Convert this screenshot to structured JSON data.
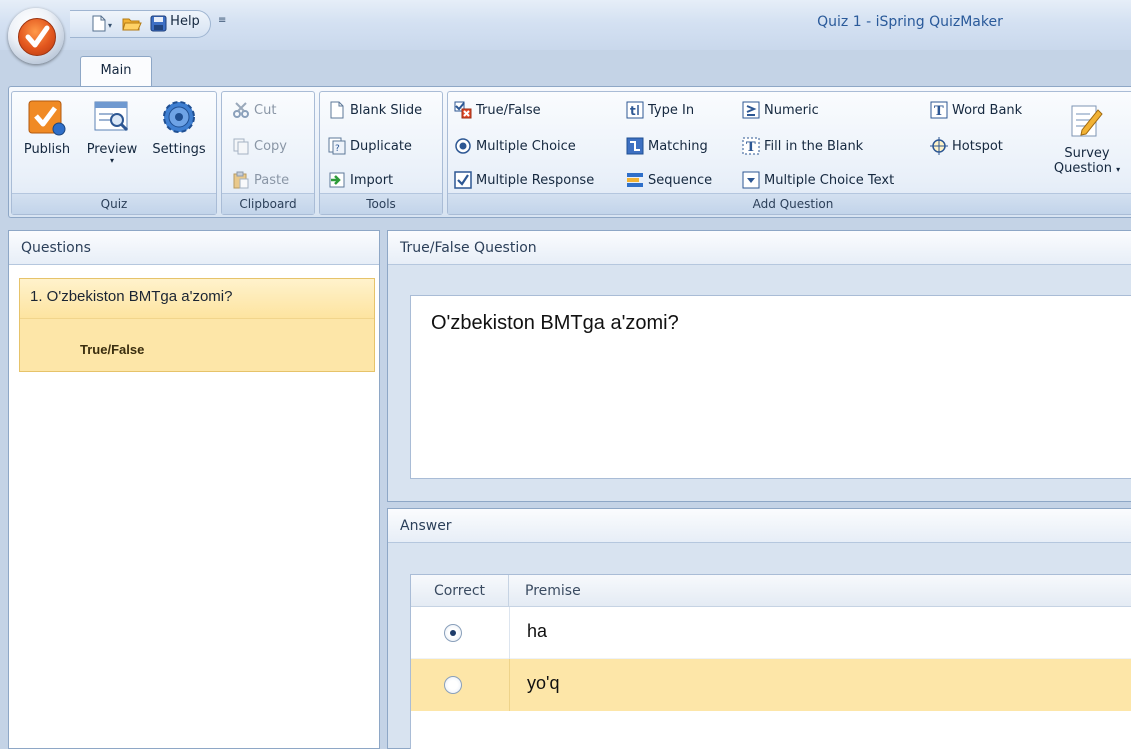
{
  "window": {
    "title": "Quiz 1 - iSpring QuizMaker"
  },
  "qat": {
    "icons": [
      "new-icon",
      "open-icon",
      "save-icon",
      "customize-icon"
    ]
  },
  "ribbon": {
    "tabs": [
      {
        "label": "Main",
        "active": true
      },
      {
        "label": "Help",
        "active": false
      }
    ],
    "groups": {
      "quiz": {
        "label": "Quiz",
        "publish": "Publish",
        "preview": "Preview",
        "settings": "Settings"
      },
      "clipboard": {
        "label": "Clipboard",
        "cut": "Cut",
        "copy": "Copy",
        "paste": "Paste"
      },
      "tools": {
        "label": "Tools",
        "blank_slide": "Blank Slide",
        "duplicate": "Duplicate",
        "import": "Import"
      },
      "add_question": {
        "label": "Add Question",
        "true_false": "True/False",
        "multiple_choice": "Multiple Choice",
        "multiple_response": "Multiple Response",
        "type_in": "Type In",
        "matching": "Matching",
        "sequence": "Sequence",
        "numeric": "Numeric",
        "fill_in_blank": "Fill in the Blank",
        "multiple_choice_text": "Multiple Choice Text",
        "word_bank": "Word Bank",
        "hotspot": "Hotspot",
        "survey_line1": "Survey",
        "survey_line2": "Question"
      }
    }
  },
  "questions_panel": {
    "header": "Questions",
    "items": [
      {
        "text": "1. O'zbekiston BMTga a'zomi?",
        "type": "True/False"
      }
    ]
  },
  "question_panel": {
    "header": "True/False Question",
    "text": "O'zbekiston BMTga a'zomi?"
  },
  "answer_panel": {
    "header": "Answer",
    "columns": {
      "correct": "Correct",
      "premise": "Premise"
    },
    "rows": [
      {
        "premise": "ha",
        "correct": true
      },
      {
        "premise": "yo'q",
        "correct": false
      }
    ]
  },
  "colors": {
    "accent": "#fde6a8",
    "ribbon": "#dfe9f5",
    "title": "#2a5a9a"
  }
}
